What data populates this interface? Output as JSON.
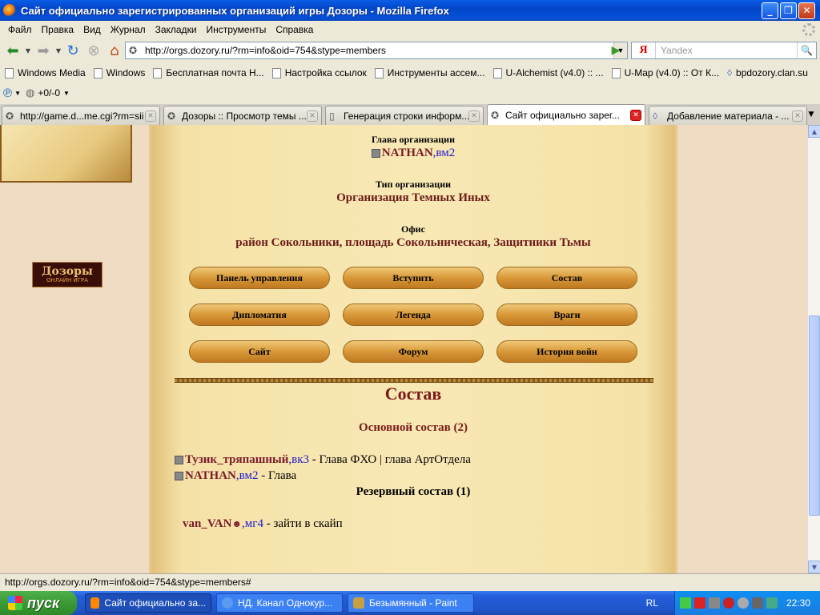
{
  "window": {
    "title": "Сайт официально зарегистрированных организаций игры Дозоры - Mozilla Firefox"
  },
  "menu": [
    "Файл",
    "Правка",
    "Вид",
    "Журнал",
    "Закладки",
    "Инструменты",
    "Справка"
  ],
  "nav": {
    "url": "http://orgs.dozory.ru/?rm=info&oid=754&stype=members",
    "search_placeholder": "Yandex",
    "search_engine": "Я"
  },
  "bookmarks": [
    "Windows Media",
    "Windows",
    "Бесплатная почта Н...",
    "Настройка ссылок",
    "Инструменты ассем...",
    "U-Alchemist (v4.0) :: ...",
    "U-Map (v4.0) :: От К...",
    "bpdozory.clan.su"
  ],
  "addon": {
    "counter": "+0/-0"
  },
  "tabs": [
    {
      "label": "http://game.d...me.cgi?rm=sii",
      "active": false
    },
    {
      "label": "Дозоры :: Просмотр темы ...",
      "active": false
    },
    {
      "label": "Генерация строки информ...",
      "active": false
    },
    {
      "label": "Сайт официально зарег...",
      "active": true
    },
    {
      "label": "Добавление материала - ...",
      "active": false
    }
  ],
  "page": {
    "logo_text": "Дозоры",
    "logo_sub": "ОНЛАЙН ИГРА",
    "head_label": "Глава организации",
    "head_name": "NATHAN",
    "head_rank": ",вм2",
    "type_label": "Тип организации",
    "type_value": "Организация Темных Иных",
    "office_label": "Офис",
    "office_value": "район Сокольники, площадь Сокольническая, Защитники Тьмы",
    "buttons": [
      "Панель управления",
      "Вступить",
      "Состав",
      "Дипломатия",
      "Легенда",
      "Враги",
      "Сайт",
      "Форум",
      "История войн"
    ],
    "section_title": "Состав",
    "main_title": "Основной состав (2)",
    "members": [
      {
        "name": "Тузик_тряпашный",
        "rank": ",вк3",
        "note": " - Глава ФХО | глава АртОтдела"
      },
      {
        "name": "NATHAN",
        "rank": ",вм2",
        "note": " - Глава"
      }
    ],
    "reserve_title": "Резервный состав (1)",
    "reserve": [
      {
        "name": "van_VAN",
        "rank": ",мг4",
        "note": " - зайти в скайп"
      }
    ]
  },
  "status": "http://orgs.dozory.ru/?rm=info&oid=754&stype=members#",
  "taskbar": {
    "start": "пуск",
    "tasks": [
      "Сайт официально за...",
      "НД. Канал Однокур...",
      "Безымянный - Paint"
    ],
    "lang": "RL",
    "clock": "22:30"
  }
}
